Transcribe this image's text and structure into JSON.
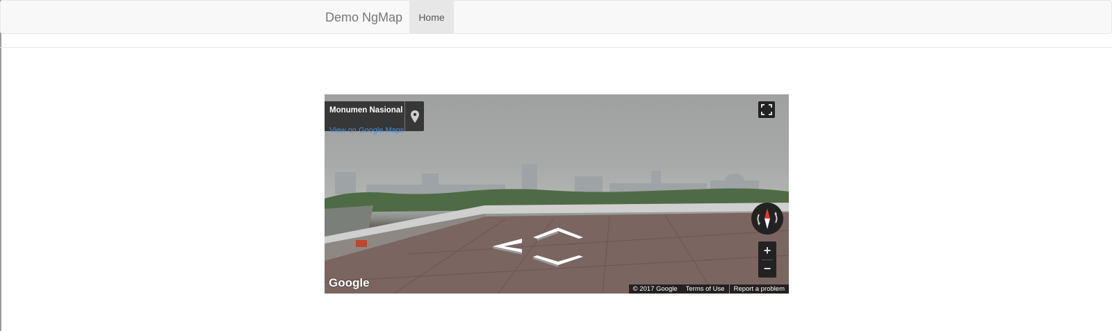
{
  "navbar": {
    "brand": "Demo NgMap",
    "items": [
      {
        "label": "Home",
        "active": true
      }
    ]
  },
  "streetview": {
    "location_title": "Monumen Nasional",
    "map_link": "View on Google Maps",
    "logo": "Google",
    "copyright": "© 2017 Google",
    "terms": "Terms of Use",
    "report": "Report a problem",
    "zoom_in": "+",
    "zoom_out": "−",
    "icons": [
      "map-pin-icon",
      "fullscreen-icon",
      "compass-icon",
      "nav-arrow-left-icon",
      "nav-arrow-up-icon",
      "nav-arrow-down-icon"
    ],
    "colors": {
      "link": "#4a90d9",
      "compass_needle": "#e53935",
      "control_bg": "#222222"
    }
  }
}
